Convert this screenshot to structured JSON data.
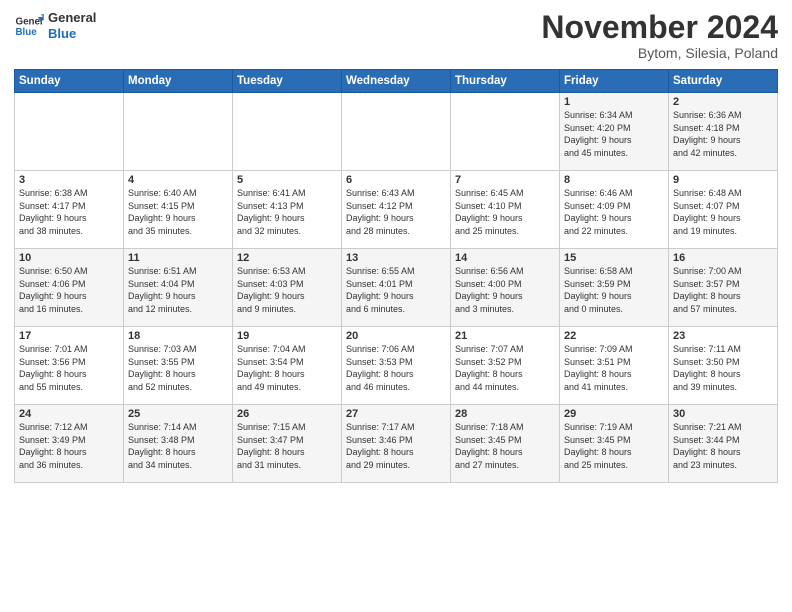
{
  "logo": {
    "line1": "General",
    "line2": "Blue"
  },
  "title": "November 2024",
  "location": "Bytom, Silesia, Poland",
  "weekdays": [
    "Sunday",
    "Monday",
    "Tuesday",
    "Wednesday",
    "Thursday",
    "Friday",
    "Saturday"
  ],
  "rows": [
    [
      {
        "day": "",
        "info": ""
      },
      {
        "day": "",
        "info": ""
      },
      {
        "day": "",
        "info": ""
      },
      {
        "day": "",
        "info": ""
      },
      {
        "day": "",
        "info": ""
      },
      {
        "day": "1",
        "info": "Sunrise: 6:34 AM\nSunset: 4:20 PM\nDaylight: 9 hours\nand 45 minutes."
      },
      {
        "day": "2",
        "info": "Sunrise: 6:36 AM\nSunset: 4:18 PM\nDaylight: 9 hours\nand 42 minutes."
      }
    ],
    [
      {
        "day": "3",
        "info": "Sunrise: 6:38 AM\nSunset: 4:17 PM\nDaylight: 9 hours\nand 38 minutes."
      },
      {
        "day": "4",
        "info": "Sunrise: 6:40 AM\nSunset: 4:15 PM\nDaylight: 9 hours\nand 35 minutes."
      },
      {
        "day": "5",
        "info": "Sunrise: 6:41 AM\nSunset: 4:13 PM\nDaylight: 9 hours\nand 32 minutes."
      },
      {
        "day": "6",
        "info": "Sunrise: 6:43 AM\nSunset: 4:12 PM\nDaylight: 9 hours\nand 28 minutes."
      },
      {
        "day": "7",
        "info": "Sunrise: 6:45 AM\nSunset: 4:10 PM\nDaylight: 9 hours\nand 25 minutes."
      },
      {
        "day": "8",
        "info": "Sunrise: 6:46 AM\nSunset: 4:09 PM\nDaylight: 9 hours\nand 22 minutes."
      },
      {
        "day": "9",
        "info": "Sunrise: 6:48 AM\nSunset: 4:07 PM\nDaylight: 9 hours\nand 19 minutes."
      }
    ],
    [
      {
        "day": "10",
        "info": "Sunrise: 6:50 AM\nSunset: 4:06 PM\nDaylight: 9 hours\nand 16 minutes."
      },
      {
        "day": "11",
        "info": "Sunrise: 6:51 AM\nSunset: 4:04 PM\nDaylight: 9 hours\nand 12 minutes."
      },
      {
        "day": "12",
        "info": "Sunrise: 6:53 AM\nSunset: 4:03 PM\nDaylight: 9 hours\nand 9 minutes."
      },
      {
        "day": "13",
        "info": "Sunrise: 6:55 AM\nSunset: 4:01 PM\nDaylight: 9 hours\nand 6 minutes."
      },
      {
        "day": "14",
        "info": "Sunrise: 6:56 AM\nSunset: 4:00 PM\nDaylight: 9 hours\nand 3 minutes."
      },
      {
        "day": "15",
        "info": "Sunrise: 6:58 AM\nSunset: 3:59 PM\nDaylight: 9 hours\nand 0 minutes."
      },
      {
        "day": "16",
        "info": "Sunrise: 7:00 AM\nSunset: 3:57 PM\nDaylight: 8 hours\nand 57 minutes."
      }
    ],
    [
      {
        "day": "17",
        "info": "Sunrise: 7:01 AM\nSunset: 3:56 PM\nDaylight: 8 hours\nand 55 minutes."
      },
      {
        "day": "18",
        "info": "Sunrise: 7:03 AM\nSunset: 3:55 PM\nDaylight: 8 hours\nand 52 minutes."
      },
      {
        "day": "19",
        "info": "Sunrise: 7:04 AM\nSunset: 3:54 PM\nDaylight: 8 hours\nand 49 minutes."
      },
      {
        "day": "20",
        "info": "Sunrise: 7:06 AM\nSunset: 3:53 PM\nDaylight: 8 hours\nand 46 minutes."
      },
      {
        "day": "21",
        "info": "Sunrise: 7:07 AM\nSunset: 3:52 PM\nDaylight: 8 hours\nand 44 minutes."
      },
      {
        "day": "22",
        "info": "Sunrise: 7:09 AM\nSunset: 3:51 PM\nDaylight: 8 hours\nand 41 minutes."
      },
      {
        "day": "23",
        "info": "Sunrise: 7:11 AM\nSunset: 3:50 PM\nDaylight: 8 hours\nand 39 minutes."
      }
    ],
    [
      {
        "day": "24",
        "info": "Sunrise: 7:12 AM\nSunset: 3:49 PM\nDaylight: 8 hours\nand 36 minutes."
      },
      {
        "day": "25",
        "info": "Sunrise: 7:14 AM\nSunset: 3:48 PM\nDaylight: 8 hours\nand 34 minutes."
      },
      {
        "day": "26",
        "info": "Sunrise: 7:15 AM\nSunset: 3:47 PM\nDaylight: 8 hours\nand 31 minutes."
      },
      {
        "day": "27",
        "info": "Sunrise: 7:17 AM\nSunset: 3:46 PM\nDaylight: 8 hours\nand 29 minutes."
      },
      {
        "day": "28",
        "info": "Sunrise: 7:18 AM\nSunset: 3:45 PM\nDaylight: 8 hours\nand 27 minutes."
      },
      {
        "day": "29",
        "info": "Sunrise: 7:19 AM\nSunset: 3:45 PM\nDaylight: 8 hours\nand 25 minutes."
      },
      {
        "day": "30",
        "info": "Sunrise: 7:21 AM\nSunset: 3:44 PM\nDaylight: 8 hours\nand 23 minutes."
      }
    ]
  ]
}
